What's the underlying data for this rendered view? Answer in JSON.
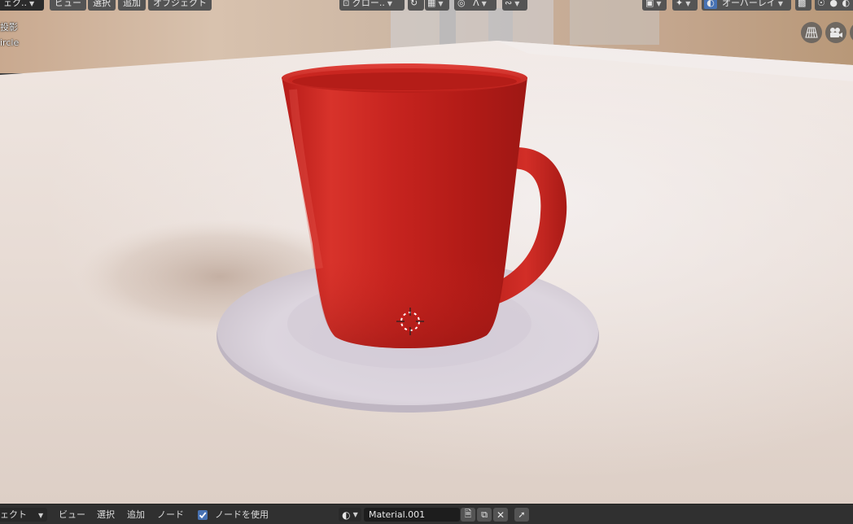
{
  "viewport": {
    "overlay": {
      "line1": "投影",
      "line2": "ircle"
    }
  },
  "header": {
    "mode_label": "ェク..",
    "menu": {
      "view": "ビュー",
      "select": "選択",
      "add": "追加",
      "object": "オブジェクト"
    },
    "transform_orientation": "グロー..",
    "overlay_label": "オーバーレイ"
  },
  "node_header": {
    "editor_label": "ェクト",
    "menu": {
      "view": "ビュー",
      "select": "選択",
      "add": "追加",
      "node": "ノード"
    },
    "use_nodes_label": "ノードを使用",
    "use_nodes_checked": true,
    "material_name": "Material.001"
  },
  "icons": {
    "cursor": "3d-cursor-icon",
    "grid": "grid-perspective-icon",
    "camera": "camera-icon"
  },
  "colors": {
    "mug": "#c4221e",
    "saucer": "#d8d3da",
    "table": "#e8ddd6",
    "checkbox": "#4772b3"
  }
}
